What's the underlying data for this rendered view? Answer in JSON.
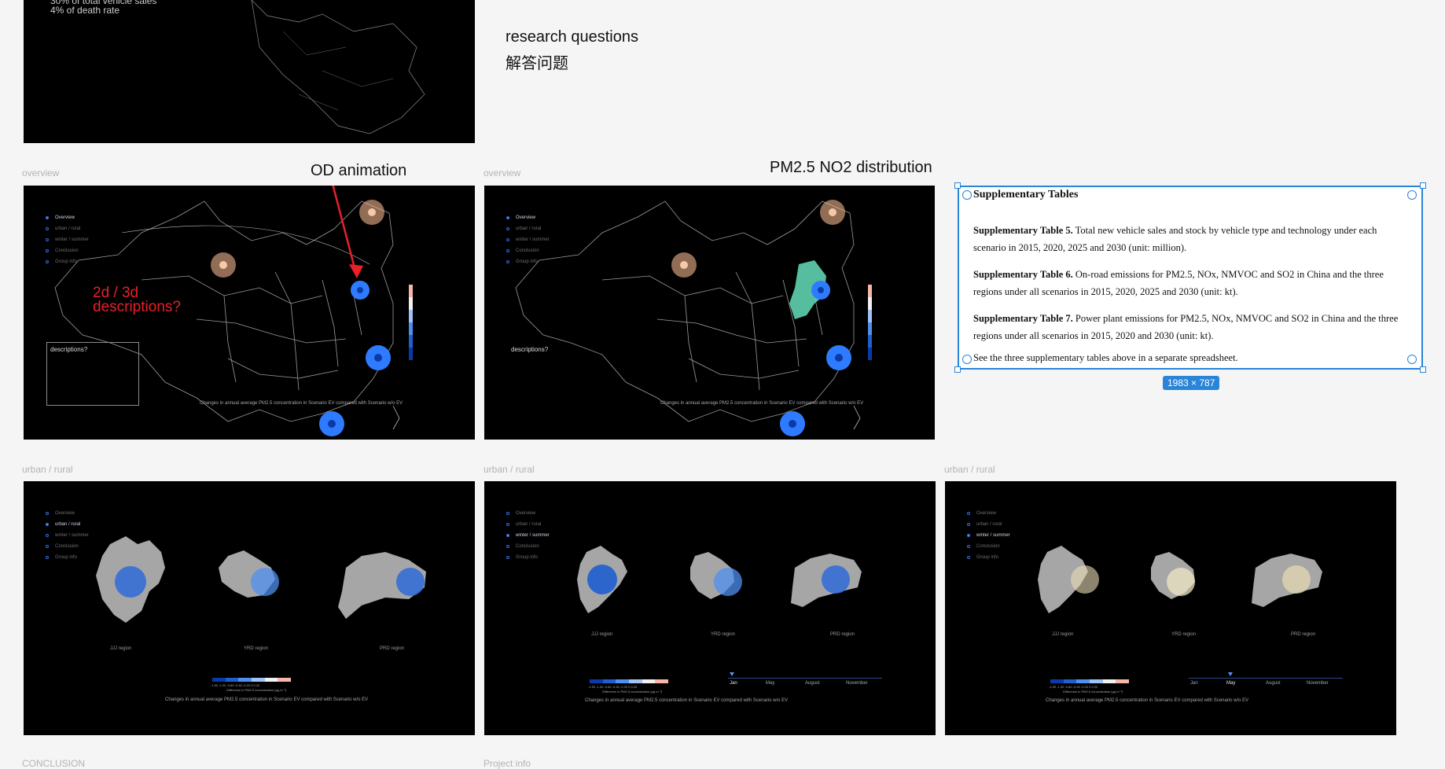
{
  "top_frame": {
    "lines": [
      "30% of total vehicle sales",
      "4% of death rate"
    ]
  },
  "research": {
    "title": "research questions",
    "subtitle": "解答问题"
  },
  "labels": {
    "overview": "overview",
    "urban_rural": "urban / rural",
    "conclusion": "CONCLUSION",
    "project_info": "Project info"
  },
  "annotations": {
    "od_animation": "OD animation",
    "pm_distribution": "PM2.5 NO2 distribution",
    "dimension": "2d / 3d\ndescriptions?",
    "descriptions": "descriptions?"
  },
  "nav_items": [
    "Overview",
    "urban / rural",
    "winter / summer",
    "Conclusion",
    "Group info"
  ],
  "captions": {
    "map": "Changes in annual average PM2.5 concentration in Scenario EV compared with Scenario w/o EV",
    "regions": "Changes in annual average PM2.5 concentration in Scenario EV compared with Scenario w/o EV",
    "legend_unit": "Difference in PM2.5 concentration (μg m⁻³)",
    "legend_ticks": "-1.50  -1.00  -0.80  -0.50  -0.20   0   0.20"
  },
  "regions": [
    "JJJ region",
    "YRD region",
    "PRD region"
  ],
  "months": [
    "Jan",
    "May",
    "August",
    "November"
  ],
  "supplementary": {
    "title": "Supplementary Tables",
    "rows": [
      {
        "bold": "Supplementary Table 5.",
        "text": " Total new vehicle sales and stock by vehicle type and technology under each scenario in 2015, 2020, 2025 and 2030 (unit: million)."
      },
      {
        "bold": "Supplementary Table 6.",
        "text": " On-road emissions for PM2.5, NOx, NMVOC and SO2 in China and the three regions under all scenarios in 2015, 2020, 2025 and 2030 (unit: kt)."
      },
      {
        "bold": "Supplementary Table 7.",
        "text": " Power plant emissions for PM2.5, NOx, NMVOC and SO2 in China and the three regions under all scenarios in 2015, 2020 and 2030 (unit: kt)."
      }
    ],
    "footer": "See the three supplementary tables above in a separate spreadsheet.",
    "dimension_badge": "1983 × 787"
  },
  "colors": {
    "selection": "#2a84d8",
    "annotation_red": "#e8202a",
    "marker_blue": "#2f7bff",
    "marker_peach": "#f2b58f",
    "beijing_green": "#5fd3b0"
  }
}
